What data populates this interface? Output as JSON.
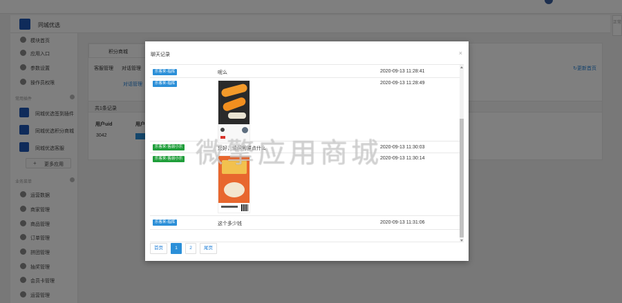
{
  "app": {
    "title": "同城优选",
    "right_strip": "正常"
  },
  "sidebar": {
    "items": [
      {
        "label": "模块首页",
        "icon": "home-icon"
      },
      {
        "label": "应用入口",
        "icon": "chat-icon"
      },
      {
        "label": "参数设置",
        "icon": "settings-icon"
      },
      {
        "label": "操作员权限",
        "icon": "user-icon"
      }
    ],
    "plugin_section": "常用插件",
    "plugins": [
      {
        "label": "同城优选签到插件"
      },
      {
        "label": "同城优选积分商城"
      },
      {
        "label": "同城优选客服"
      }
    ],
    "more_label": "更多应用",
    "business_section": "业务菜单",
    "business_items": [
      {
        "label": "运营数据",
        "icon": "gear-icon"
      },
      {
        "label": "商家管理",
        "icon": "gear-icon"
      },
      {
        "label": "商品管理",
        "icon": "gear-icon"
      },
      {
        "label": "订单管理",
        "icon": "gear-icon"
      },
      {
        "label": "拼团管理",
        "icon": "gear-icon"
      },
      {
        "label": "抽奖管理",
        "icon": "gear-icon"
      },
      {
        "label": "会员卡管理",
        "icon": "gear-icon"
      },
      {
        "label": "运营管理",
        "icon": "gear-icon"
      }
    ]
  },
  "main": {
    "tab_label": "积分商城",
    "sub_tabs": [
      "客服管理",
      "对话管理"
    ],
    "link_text": "对话管理",
    "refresh_label": "更新首页",
    "count_text": "共1条记录",
    "columns": [
      "用户uid",
      "用户"
    ],
    "row_uid": "3042"
  },
  "modal": {
    "title": "聊天记录",
    "close_glyph": "×",
    "messages": [
      {
        "badge": "乐客来-指挥",
        "badge_color": "#2b8fd8",
        "text": "呢么",
        "time": "2020-09-13 11:28:41"
      },
      {
        "badge": "乐客来-指挥",
        "badge_color": "#2b8fd8",
        "text": "",
        "image": "sushi-product-image",
        "time": "2020-09-13 11:28:49"
      },
      {
        "badge": "乐客来-售前小乐",
        "badge_color": "#1f9e3a",
        "text": "您好，请问需要点什么",
        "time": "2020-09-13 11:30:03"
      },
      {
        "badge": "乐客来-售前小乐",
        "badge_color": "#1f9e3a",
        "text": "",
        "image": "food-poster-image",
        "time": "2020-09-13 11:30:14"
      },
      {
        "badge": "乐客来-指挥",
        "badge_color": "#2b8fd8",
        "text": "这个多少钱",
        "time": "2020-09-13 11:31:06"
      }
    ],
    "pagination": {
      "first": "首页",
      "pages": [
        "1",
        "2"
      ],
      "current": "1",
      "last": "尾页"
    }
  },
  "watermark": "微擎应用商城"
}
